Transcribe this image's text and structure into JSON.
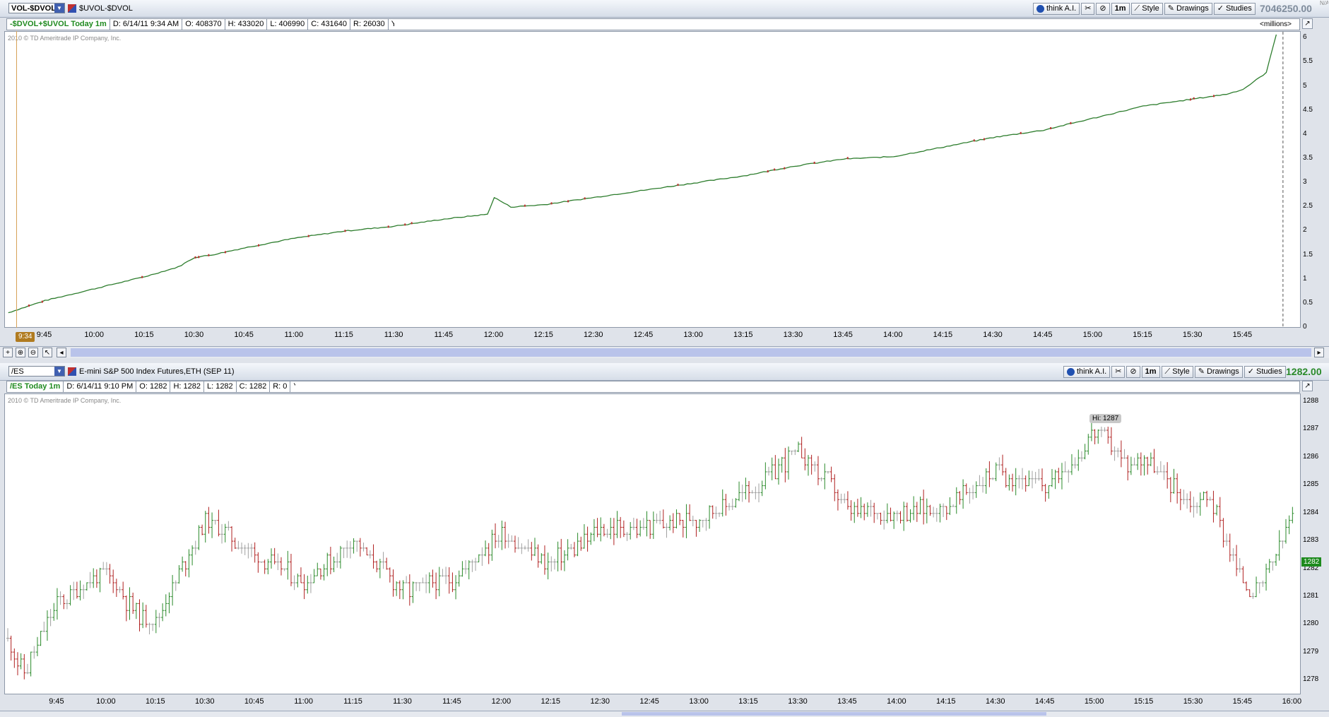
{
  "top": {
    "symbol": "VOL-$DVOL",
    "description": "$UVOL-$DVOL",
    "toolbar": {
      "think": "think A.I.",
      "interval": "1m",
      "style": "Style",
      "drawings": "Drawings",
      "studies": "Studies"
    },
    "last_price": "7046250.00",
    "side_marker": "N/A",
    "info": {
      "name": "-$DVOL+$UVOL Today 1m",
      "date": "D: 6/14/11 9:34 AM",
      "open": "O: 408370",
      "high": "H: 433020",
      "low": "L: 406990",
      "close": "C: 431640",
      "range": "R: 26030",
      "y": "Y:"
    },
    "units": "<millions>",
    "copyright": "2010 © TD Ameritrade IP Company, Inc.",
    "cursor_time": "9:34",
    "xticks": [
      "9:45",
      "10:00",
      "10:15",
      "10:30",
      "10:45",
      "11:00",
      "11:15",
      "11:30",
      "11:45",
      "12:00",
      "12:15",
      "12:30",
      "12:45",
      "13:00",
      "13:15",
      "13:30",
      "13:45",
      "14:00",
      "14:15",
      "14:30",
      "14:45",
      "15:00",
      "15:15",
      "15:30",
      "15:45"
    ],
    "yticks": [
      "0",
      "0.5",
      "1",
      "1.5",
      "2",
      "2.5",
      "3",
      "3.5",
      "4",
      "4.5",
      "5",
      "5.5",
      "6"
    ]
  },
  "bottom": {
    "symbol": "/ES",
    "description": "E-mini S&P 500 Index Futures,ETH (SEP 11)",
    "toolbar": {
      "think": "think A.I.",
      "interval": "1m",
      "style": "Style",
      "drawings": "Drawings",
      "studies": "Studies"
    },
    "last_price": "1282.00",
    "info": {
      "name": "/ES Today 1m",
      "date": "D: 6/14/11 9:10 PM",
      "open": "O: 1282",
      "high": "H: 1282",
      "low": "L: 1282",
      "close": "C: 1282",
      "range": "R: 0",
      "y": "Y:"
    },
    "copyright": "2010 © TD Ameritrade IP Company, Inc.",
    "hi_label": "Hi: 1287",
    "last_badge": "1282",
    "xticks": [
      "9:45",
      "10:00",
      "10:15",
      "10:30",
      "10:45",
      "11:00",
      "11:15",
      "11:30",
      "11:45",
      "12:00",
      "12:15",
      "12:30",
      "12:45",
      "13:00",
      "13:15",
      "13:30",
      "13:45",
      "14:00",
      "14:15",
      "14:30",
      "14:45",
      "15:00",
      "15:15",
      "15:30",
      "15:45",
      "16:00"
    ],
    "yticks": [
      "1278",
      "1279",
      "1280",
      "1281",
      "1282",
      "1283",
      "1284",
      "1285",
      "1286",
      "1287",
      "1288"
    ]
  },
  "chart_data": [
    {
      "type": "line",
      "title": "-$DVOL+$UVOL Today 1m",
      "ylabel": "<millions>",
      "ylim": [
        0,
        6.1
      ],
      "x": [
        "9:34",
        "9:45",
        "10:00",
        "10:15",
        "10:25",
        "10:30",
        "10:35",
        "10:45",
        "11:00",
        "11:15",
        "11:30",
        "11:45",
        "11:58",
        "12:00",
        "12:05",
        "12:15",
        "12:30",
        "12:45",
        "13:00",
        "13:15",
        "13:30",
        "13:45",
        "14:00",
        "14:15",
        "14:30",
        "14:45",
        "15:00",
        "15:15",
        "15:30",
        "15:40",
        "15:45",
        "15:52",
        "15:55"
      ],
      "series": [
        {
          "values": [
            0.3,
            0.55,
            0.8,
            1.05,
            1.25,
            1.45,
            1.5,
            1.65,
            1.85,
            2.0,
            2.1,
            2.25,
            2.35,
            2.7,
            2.5,
            2.55,
            2.7,
            2.85,
            3.0,
            3.15,
            3.35,
            3.5,
            3.55,
            3.75,
            3.95,
            4.1,
            4.35,
            4.6,
            4.75,
            4.85,
            4.95,
            5.3,
            6.1
          ]
        }
      ]
    },
    {
      "type": "line",
      "title": "/ES Today 1m",
      "ylim": [
        1277.5,
        1288.3
      ],
      "x": [
        "9:30",
        "9:35",
        "9:45",
        "10:00",
        "10:10",
        "10:15",
        "10:30",
        "10:45",
        "11:00",
        "11:15",
        "11:30",
        "11:45",
        "12:00",
        "12:15",
        "12:30",
        "12:45",
        "13:00",
        "13:15",
        "13:30",
        "13:40",
        "13:45",
        "14:00",
        "14:15",
        "14:30",
        "14:45",
        "14:55",
        "15:00",
        "15:10",
        "15:15",
        "15:30",
        "15:35",
        "15:45",
        "15:50",
        "16:00"
      ],
      "series": [
        {
          "values": [
            1279.5,
            1278.2,
            1280.8,
            1281.9,
            1280.2,
            1280.1,
            1283.8,
            1282.5,
            1281.5,
            1283.0,
            1281.2,
            1281.6,
            1283.3,
            1282.2,
            1283.4,
            1283.5,
            1283.8,
            1284.8,
            1286.2,
            1285.0,
            1284.1,
            1284.0,
            1284.2,
            1285.5,
            1285.0,
            1286.1,
            1287.0,
            1285.8,
            1286.0,
            1284.3,
            1284.6,
            1281.5,
            1281.2,
            1283.9
          ]
        }
      ]
    }
  ]
}
